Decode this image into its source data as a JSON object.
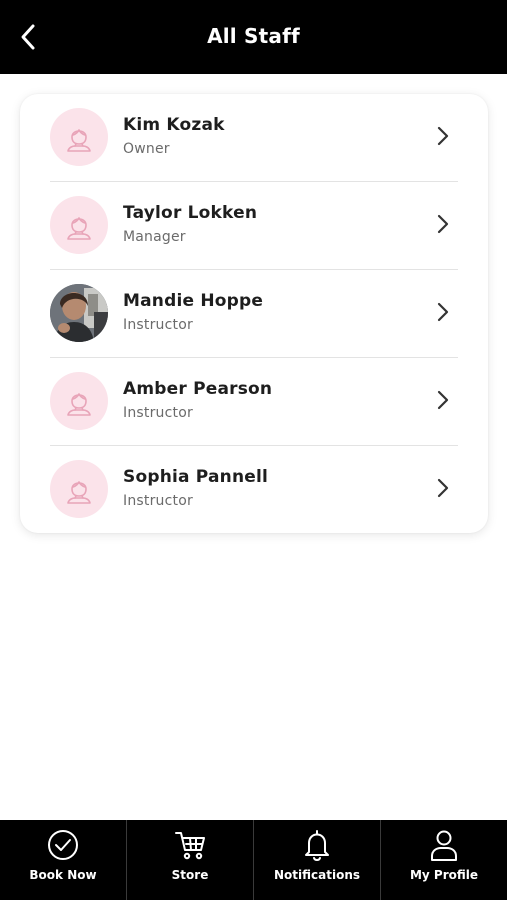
{
  "header": {
    "title": "All Staff"
  },
  "staff": [
    {
      "name": "Kim Kozak",
      "role": "Owner",
      "avatar": "placeholder-person-icon"
    },
    {
      "name": "Taylor Lokken",
      "role": "Manager",
      "avatar": "placeholder-person-icon"
    },
    {
      "name": "Mandie Hoppe",
      "role": "Instructor",
      "avatar": "photo"
    },
    {
      "name": "Amber Pearson",
      "role": "Instructor",
      "avatar": "placeholder-person-icon"
    },
    {
      "name": "Sophia Pannell",
      "role": "Instructor",
      "avatar": "placeholder-person-icon"
    }
  ],
  "bottom_nav": [
    {
      "label": "Book Now",
      "icon": "check-circle-icon"
    },
    {
      "label": "Store",
      "icon": "cart-icon"
    },
    {
      "label": "Notifications",
      "icon": "bell-icon"
    },
    {
      "label": "My Profile",
      "icon": "person-icon"
    }
  ],
  "colors": {
    "header_bg": "#000000",
    "avatar_bg": "#fbe3ea",
    "avatar_icon": "#e8a4b8"
  }
}
